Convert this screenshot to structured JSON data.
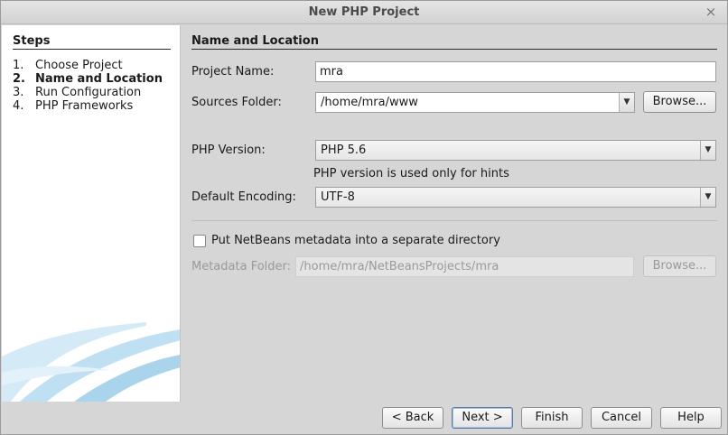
{
  "window": {
    "title": "New PHP Project",
    "close_glyph": "×"
  },
  "steps": {
    "title": "Steps",
    "items": [
      {
        "num": "1.",
        "label": "Choose Project",
        "active": false
      },
      {
        "num": "2.",
        "label": "Name and Location",
        "active": true
      },
      {
        "num": "3.",
        "label": "Run Configuration",
        "active": false
      },
      {
        "num": "4.",
        "label": "PHP Frameworks",
        "active": false
      }
    ]
  },
  "form": {
    "section_title": "Name and Location",
    "project_name": {
      "label": "Project Name:",
      "value": "mra"
    },
    "sources_folder": {
      "label": "Sources Folder:",
      "value": "/home/mra/www",
      "browse_label": "Browse..."
    },
    "php_version": {
      "label": "PHP Version:",
      "value": "PHP 5.6",
      "hint": "PHP version is used only for hints"
    },
    "default_encoding": {
      "label": "Default Encoding:",
      "value": "UTF-8"
    },
    "metadata_checkbox": {
      "label": "Put NetBeans metadata into a separate directory",
      "checked": false
    },
    "metadata_folder": {
      "label": "Metadata Folder:",
      "value": "/home/mra/NetBeansProjects/mra",
      "browse_label": "Browse..."
    }
  },
  "buttons": {
    "back": "< Back",
    "next": "Next >",
    "finish": "Finish",
    "cancel": "Cancel",
    "help": "Help"
  },
  "colors": {
    "panel_bg": "#d6d6d6",
    "steps_bg": "#ffffff",
    "swoosh": "#b9dcef"
  }
}
